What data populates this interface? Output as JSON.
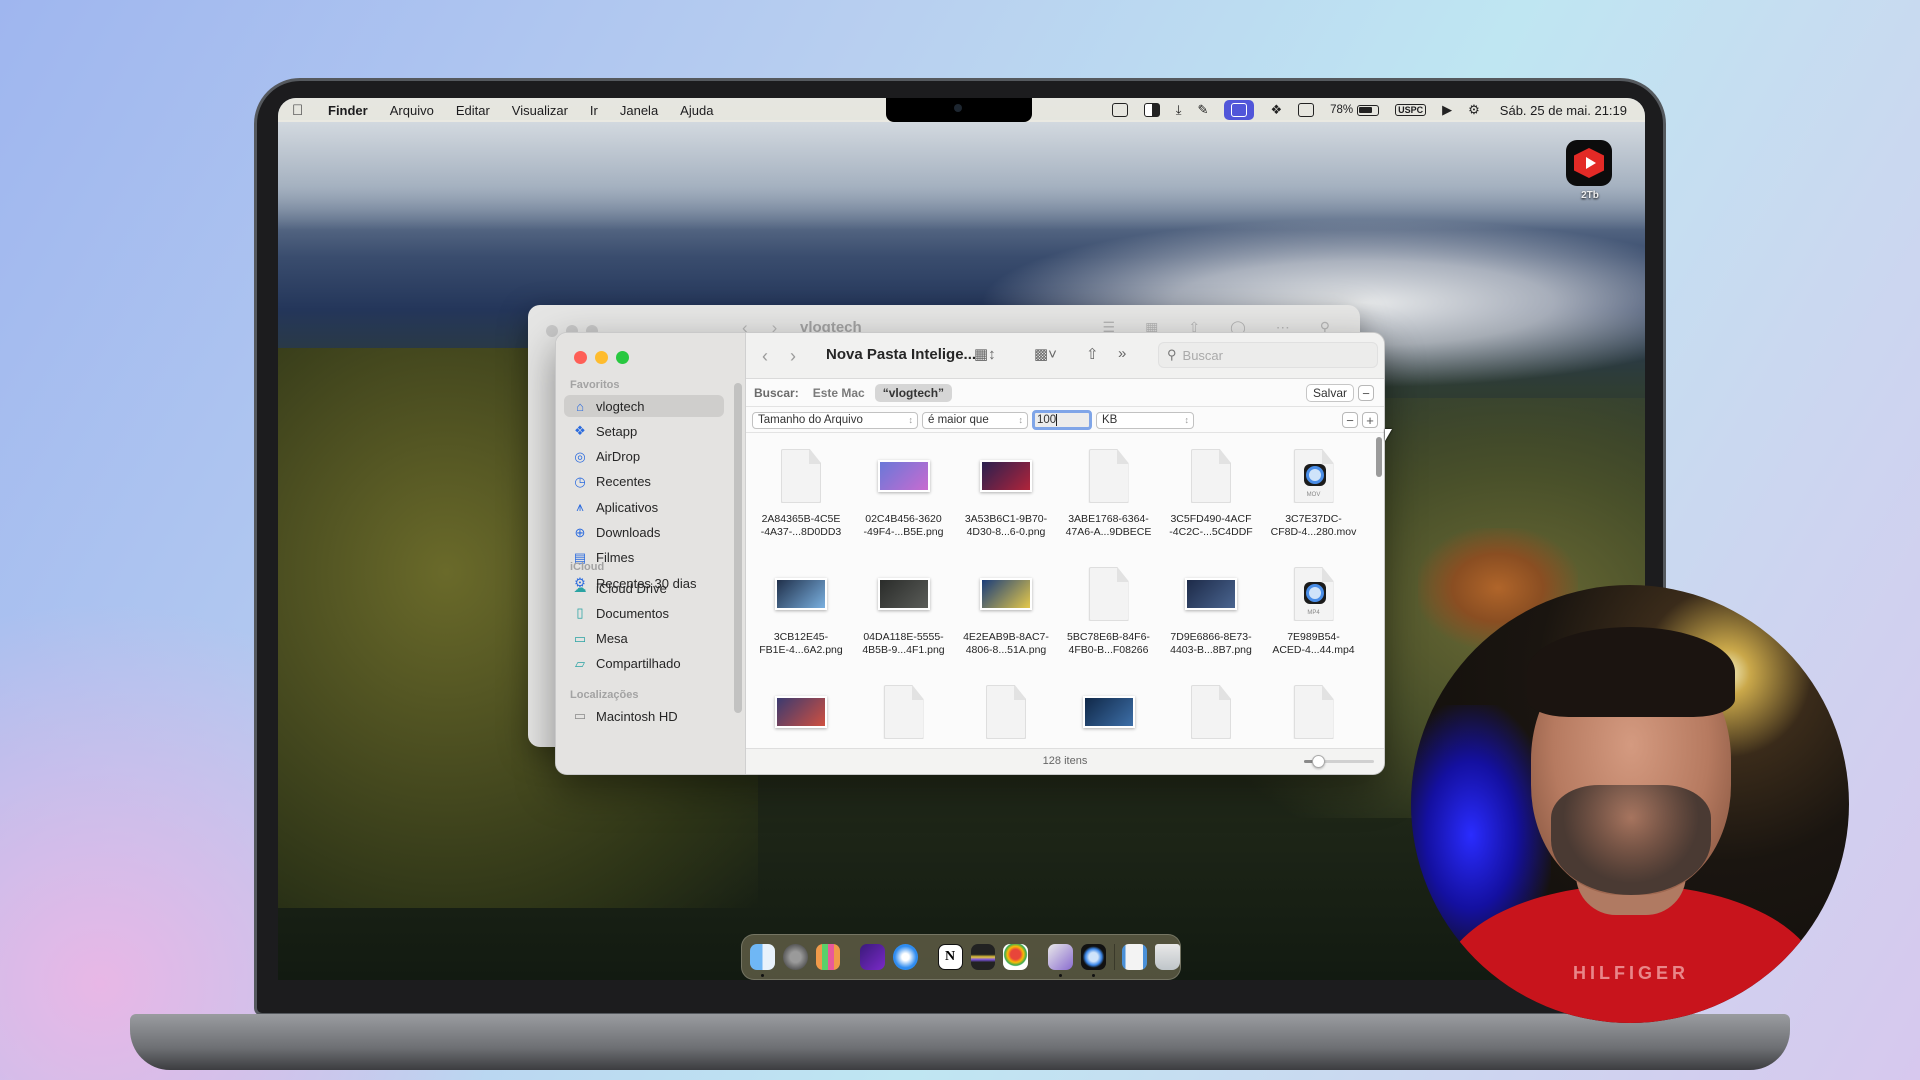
{
  "menubar": {
    "app_name": "Finder",
    "menus": [
      "Arquivo",
      "Editar",
      "Visualizar",
      "Ir",
      "Janela",
      "Ajuda"
    ],
    "status": {
      "battery_percent": "78%",
      "input_source": "USPC",
      "clock": "Sáb. 25 de mai.  21:19"
    }
  },
  "desktop": {
    "app_icon_label": "2Tb",
    "app_icon_color": "#e32a26"
  },
  "background_window": {
    "title": "vlogtech"
  },
  "finder": {
    "toolbar": {
      "title": "Nova Pasta Intelige...",
      "search_placeholder": "Buscar"
    },
    "scope": {
      "label": "Buscar:",
      "options": [
        "Este Mac",
        "“vlogtech”"
      ],
      "active_option": "“vlogtech”",
      "save_label": "Salvar"
    },
    "criteria": {
      "attribute": "Tamanho do Arquivo",
      "operator": "é maior que",
      "value": "100",
      "unit": "KB"
    },
    "sidebar": {
      "sections": [
        {
          "title": "Favoritos",
          "items": [
            {
              "label": "vlogtech",
              "icon": "home-icon",
              "selected": true
            },
            {
              "label": "Setapp",
              "icon": "setapp-icon"
            },
            {
              "label": "AirDrop",
              "icon": "airdrop-icon"
            },
            {
              "label": "Recentes",
              "icon": "clock-icon"
            },
            {
              "label": "Aplicativos",
              "icon": "applications-icon"
            },
            {
              "label": "Downloads",
              "icon": "download-icon"
            },
            {
              "label": "Filmes",
              "icon": "film-icon"
            },
            {
              "label": "Recentes 30 dias",
              "icon": "gear-icon"
            }
          ]
        },
        {
          "title": "iCloud",
          "items": [
            {
              "label": "iCloud Drive",
              "icon": "cloud-icon"
            },
            {
              "label": "Documentos",
              "icon": "document-icon"
            },
            {
              "label": "Mesa",
              "icon": "desktop-icon"
            },
            {
              "label": "Compartilhado",
              "icon": "shared-folder-icon"
            }
          ]
        },
        {
          "title": "Localizações",
          "items": [
            {
              "label": "Macintosh HD",
              "icon": "drive-icon"
            }
          ]
        }
      ]
    },
    "files": [
      {
        "line1": "2A84365B-4C5E",
        "line2": "-4A37-...8D0DD3",
        "kind": "doc"
      },
      {
        "line1": "02C4B456-3620",
        "line2": "-49F4-...B5E.png",
        "kind": "image",
        "colors": [
          "#6a78d8",
          "#c86bd0"
        ]
      },
      {
        "line1": "3A53B6C1-9B70-",
        "line2": "4D30-8...6-0.png",
        "kind": "image",
        "colors": [
          "#2a2050",
          "#b0243a"
        ]
      },
      {
        "line1": "3ABE1768-6364-",
        "line2": "47A6-A...9DBECE",
        "kind": "doc"
      },
      {
        "line1": "3C5FD490-4ACF",
        "line2": "-4C2C-...5C4DDF",
        "kind": "doc"
      },
      {
        "line1": "3C7E37DC-",
        "line2": "CF8D-4...280.mov",
        "kind": "video",
        "ext": "MOV"
      },
      {
        "line1": "3CB12E45-",
        "line2": "FB1E-4...6A2.png",
        "kind": "image",
        "colors": [
          "#20304a",
          "#7ab0e0"
        ]
      },
      {
        "line1": "04DA118E-5555-",
        "line2": "4B5B-9...4F1.png",
        "kind": "image",
        "colors": [
          "#2a2c2a",
          "#5a5c58"
        ]
      },
      {
        "line1": "4E2EAB9B-8AC7-",
        "line2": "4806-8...51A.png",
        "kind": "image",
        "colors": [
          "#1a3d7a",
          "#e4c84a"
        ]
      },
      {
        "line1": "5BC78E6B-84F6-",
        "line2": "4FB0-B...F08266",
        "kind": "doc"
      },
      {
        "line1": "7D9E6866-8E73-",
        "line2": "4403-B...8B7.png",
        "kind": "image",
        "colors": [
          "#1d2a48",
          "#4a6590"
        ]
      },
      {
        "line1": "7E989B54-",
        "line2": "ACED-4...44.mp4",
        "kind": "video",
        "ext": "MP4"
      },
      {
        "line1": "",
        "line2": "",
        "kind": "image",
        "colors": [
          "#3a3a70",
          "#d05040"
        ]
      },
      {
        "line1": "",
        "line2": "",
        "kind": "doc"
      },
      {
        "line1": "",
        "line2": "",
        "kind": "doc"
      },
      {
        "line1": "",
        "line2": "",
        "kind": "image",
        "colors": [
          "#102848",
          "#3d6fa8"
        ]
      },
      {
        "line1": "",
        "line2": "",
        "kind": "doc"
      },
      {
        "line1": "",
        "line2": "",
        "kind": "doc"
      }
    ],
    "status": {
      "item_count": "128 itens",
      "icon_size_fraction": 0.2
    }
  },
  "dock": {
    "apps": [
      {
        "name": "finder",
        "running": true
      },
      {
        "name": "system-settings",
        "running": false
      },
      {
        "name": "launchpad",
        "running": false
      },
      {
        "name": "affinity",
        "running": false
      },
      {
        "name": "safari",
        "running": false
      },
      {
        "name": "notion",
        "running": false
      },
      {
        "name": "audio-app",
        "running": false
      },
      {
        "name": "google-maps",
        "running": false
      },
      {
        "name": "photo-booth",
        "running": true
      },
      {
        "name": "quicktime",
        "running": true
      },
      {
        "name": "downloads-stack",
        "running": false
      },
      {
        "name": "trash",
        "running": false
      }
    ],
    "notion_glyph": "N"
  },
  "webcam": {
    "shirt_text": "HILFIGER"
  }
}
